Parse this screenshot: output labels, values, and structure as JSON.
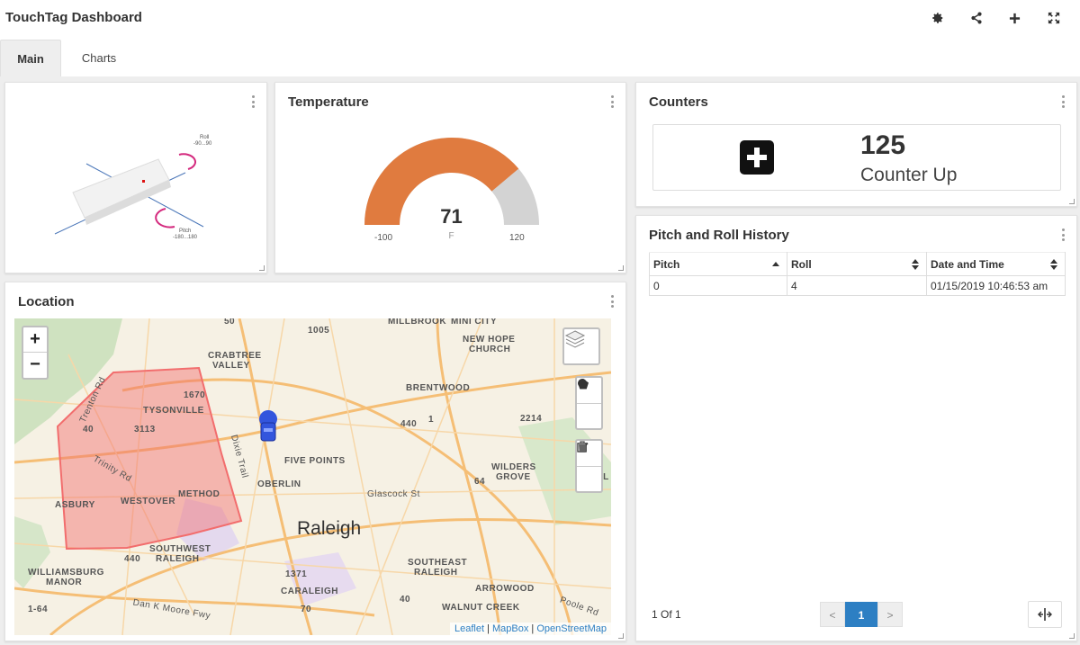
{
  "app": {
    "title": "TouchTag Dashboard"
  },
  "toolbar": {
    "icons": [
      "gear-icon",
      "share-icon",
      "plus-icon",
      "fullscreen-icon"
    ]
  },
  "tabs": [
    {
      "label": "Main",
      "active": true
    },
    {
      "label": "Charts",
      "active": false
    }
  ],
  "device_widget": {
    "roll_label": "Roll",
    "roll_range": "-90...90",
    "pitch_label": "Pitch",
    "pitch_range": "-180...180"
  },
  "temperature": {
    "title": "Temperature",
    "value": "71",
    "unit": "F",
    "min": "-100",
    "max": "120",
    "fill_color": "#e07b3f",
    "track_color": "#d3d3d3"
  },
  "counters": {
    "title": "Counters",
    "value": "125",
    "label": "Counter Up"
  },
  "history": {
    "title": "Pitch and Roll History",
    "columns": [
      "Pitch",
      "Roll",
      "Date and Time"
    ],
    "rows": [
      [
        "0",
        "4",
        "01/15/2019 10:46:53 am"
      ]
    ],
    "pager_info": "1 Of 1",
    "prev_label": "<",
    "current_page": "1",
    "next_label": ">"
  },
  "location": {
    "title": "Location",
    "zoom_in": "+",
    "zoom_out": "−",
    "labels": [
      "50",
      "1005",
      "MILLBROOK",
      "MINI CITY",
      "NEW HOPE",
      "CHURCH",
      "CRABTREE",
      "VALLEY",
      "BRENTWOOD",
      "1670",
      "TYSONVILLE",
      "3113",
      "40",
      "440",
      "1",
      "2214",
      "FIVE POINTS",
      "WILDERS",
      "GROVE",
      "MIL",
      "OBERLIN",
      "Glascock St",
      "64",
      "Trinity Rd",
      "ASBURY",
      "WESTOVER",
      "METHOD",
      "Raleigh",
      "SOUTHWEST",
      "RALEIGH",
      "440",
      "SOUTHEAST",
      "RALEIGH",
      "WILLIAMSBURG",
      "MANOR",
      "1371",
      "ARROWOOD",
      "CARALEIGH",
      "40",
      "WALNUT CREEK",
      "1-64",
      "Dan K Moore Fwy",
      "70",
      "Poole Rd",
      "Trenton Rd",
      "Dixie Trail"
    ],
    "attribution": [
      "Leaflet",
      "MapBox",
      "OpenStreetMap"
    ],
    "geofence_color": "#f26d6d"
  }
}
